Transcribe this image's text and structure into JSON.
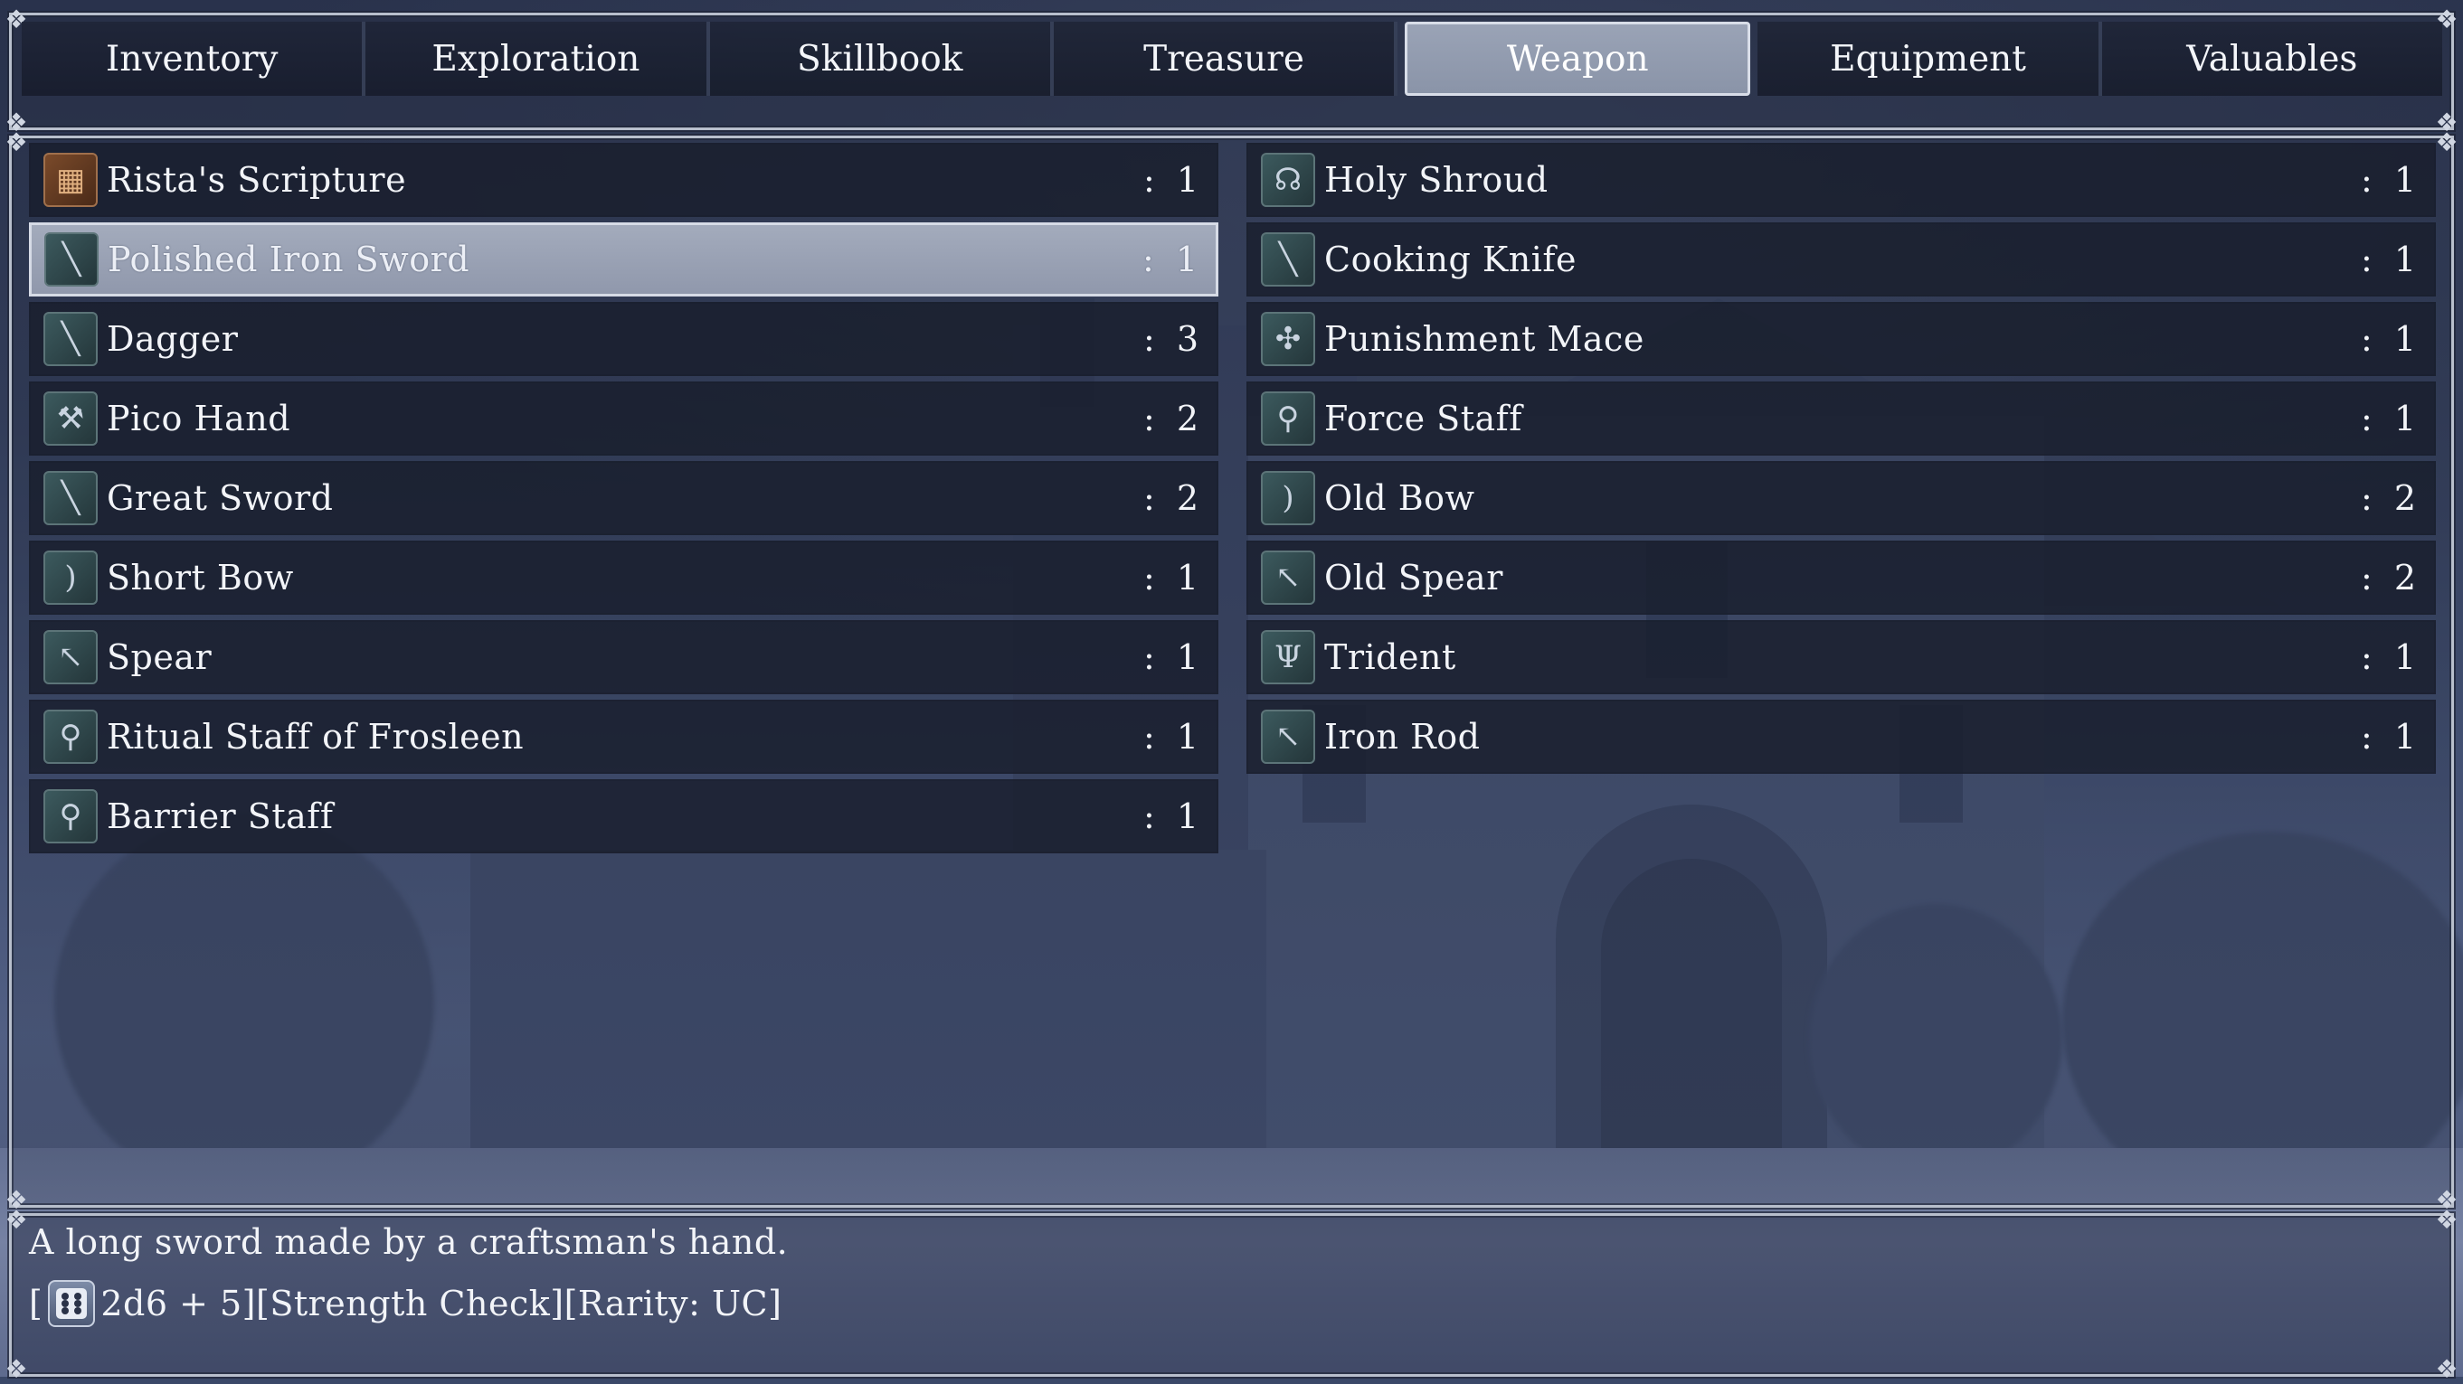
{
  "tabs": [
    {
      "label": "Inventory",
      "active": false
    },
    {
      "label": "Exploration",
      "active": false
    },
    {
      "label": "Skillbook",
      "active": false
    },
    {
      "label": "Treasure",
      "active": false
    },
    {
      "label": "Weapon",
      "active": true
    },
    {
      "label": "Equipment",
      "active": false
    },
    {
      "label": "Valuables",
      "active": false
    }
  ],
  "items_left": [
    {
      "name": "Rista's Scripture",
      "qty": ": 1",
      "icon": "book-icon"
    },
    {
      "name": "Polished Iron Sword",
      "qty": ": 1",
      "icon": "sword-icon",
      "selected": true
    },
    {
      "name": "Dagger",
      "qty": ": 3",
      "icon": "dagger-icon"
    },
    {
      "name": "Pico Hand",
      "qty": ": 2",
      "icon": "hammer-icon"
    },
    {
      "name": "Great Sword",
      "qty": ": 2",
      "icon": "sword-icon"
    },
    {
      "name": "Short Bow",
      "qty": ": 1",
      "icon": "bow-icon"
    },
    {
      "name": "Spear",
      "qty": ": 1",
      "icon": "spear-icon"
    },
    {
      "name": "Ritual Staff of Frosleen",
      "qty": ": 1",
      "icon": "staff-icon"
    },
    {
      "name": "Barrier Staff",
      "qty": ": 1",
      "icon": "staff-icon"
    }
  ],
  "items_right": [
    {
      "name": "Holy Shroud",
      "qty": ": 1",
      "icon": "shroud-icon"
    },
    {
      "name": "Cooking Knife",
      "qty": ": 1",
      "icon": "knife-icon"
    },
    {
      "name": "Punishment Mace",
      "qty": ": 1",
      "icon": "mace-icon"
    },
    {
      "name": "Force Staff",
      "qty": ": 1",
      "icon": "staff-icon"
    },
    {
      "name": "Old Bow",
      "qty": ": 2",
      "icon": "bow-icon"
    },
    {
      "name": "Old Spear",
      "qty": ": 2",
      "icon": "spear-icon"
    },
    {
      "name": "Trident",
      "qty": ": 1",
      "icon": "trident-icon"
    },
    {
      "name": "Iron Rod",
      "qty": ": 1",
      "icon": "rod-icon"
    }
  ],
  "description": {
    "line1": "A long sword made by a craftsman's hand.",
    "line2_prefix": "[",
    "line2_suffix": "2d6 + 5][Strength Check][Rarity: UC]",
    "dice_icon": "dice-icon"
  }
}
